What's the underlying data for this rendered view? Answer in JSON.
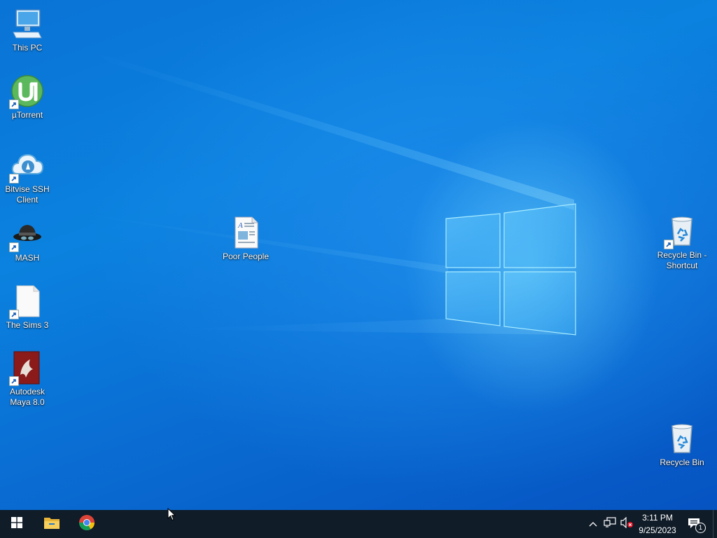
{
  "desktop": {
    "icons": [
      {
        "label": "This PC",
        "icon": "computer-icon",
        "shortcut": false
      },
      {
        "label": "µTorrent",
        "icon": "utorrent-icon",
        "shortcut": true
      },
      {
        "label": "Bitvise SSH Client",
        "icon": "bitvise-icon",
        "shortcut": true
      },
      {
        "label": "MASH",
        "icon": "mash-icon",
        "shortcut": true
      },
      {
        "label": "The Sims 3",
        "icon": "blank-file-icon",
        "shortcut": true
      },
      {
        "label": "Autodesk Maya 8.0",
        "icon": "maya-icon",
        "shortcut": true
      },
      {
        "label": "Poor People",
        "icon": "document-icon",
        "shortcut": false
      },
      {
        "label": "Recycle Bin - Shortcut",
        "icon": "recycle-bin-icon",
        "shortcut": true
      },
      {
        "label": "Recycle Bin",
        "icon": "recycle-bin-icon",
        "shortcut": false
      }
    ]
  },
  "taskbar": {
    "start": "windows-start-icon",
    "pinned": [
      "file-explorer-icon",
      "chrome-icon"
    ],
    "tray": {
      "icons": [
        "chevron-up-icon",
        "network-icon",
        "volume-muted-icon"
      ],
      "time": "3:11 PM",
      "date": "9/25/2023",
      "notification_count": "1"
    }
  },
  "colors": {
    "taskbar_bg": "#101c28",
    "desktop_blue": "#0a73d6",
    "accent_light": "#78dcff"
  }
}
